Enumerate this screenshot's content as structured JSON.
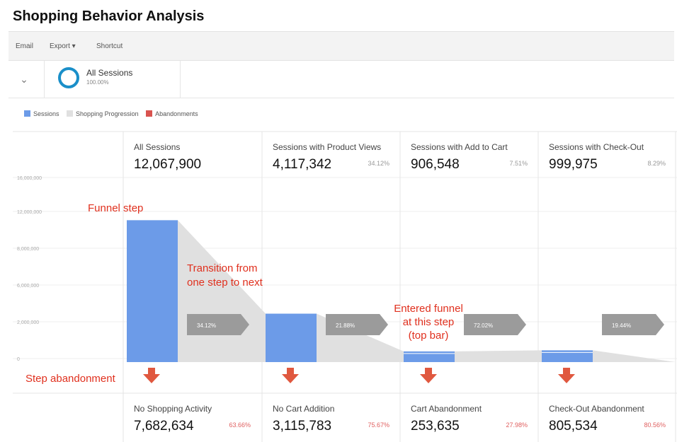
{
  "title": "Shopping Behavior Analysis",
  "toolbar": {
    "email": "Email",
    "export": "Export ▾",
    "shortcut": "Shortcut"
  },
  "segment": {
    "name": "All Sessions",
    "percent": "100.00%",
    "ring_color": "#1a8fc9"
  },
  "legend": [
    {
      "label": "Sessions",
      "color": "#6c9be8"
    },
    {
      "label": "Shopping Progression",
      "color": "#e0e0e0"
    },
    {
      "label": "Abandonments",
      "color": "#d9534f"
    }
  ],
  "chart_data": {
    "type": "bar",
    "title": "Shopping Behavior Analysis",
    "ylim": [
      0,
      16000000
    ],
    "yticks": [
      "16,000,000",
      "12,000,000",
      "8,000,000",
      "6,000,000",
      "2,000,000",
      "0"
    ],
    "steps": [
      {
        "label": "All Sessions",
        "value": 12067900,
        "value_text": "12,067,900",
        "pct": ""
      },
      {
        "label": "Sessions with Product Views",
        "value": 4117342,
        "value_text": "4,117,342",
        "pct": "34.12%"
      },
      {
        "label": "Sessions with Add to Cart",
        "value": 906548,
        "value_text": "906,548",
        "pct": "7.51%"
      },
      {
        "label": "Sessions with Check-Out",
        "value": 999975,
        "value_text": "999,975",
        "pct": "8.29%"
      }
    ],
    "transitions": [
      "34.12%",
      "21.88%",
      "72.02%",
      "19.44%"
    ],
    "abandonments": [
      {
        "label": "No Shopping Activity",
        "value": 7682634,
        "value_text": "7,682,634",
        "pct": "63.66%"
      },
      {
        "label": "No Cart Addition",
        "value": 3115783,
        "value_text": "3,115,783",
        "pct": "75.67%"
      },
      {
        "label": "Cart Abandonment",
        "value": 253635,
        "value_text": "253,635",
        "pct": "27.98%"
      },
      {
        "label": "Check-Out Abandonment",
        "value": 805534,
        "value_text": "805,534",
        "pct": "80.56%"
      }
    ],
    "annotations": {
      "funnel_step": "Funnel step",
      "transition": [
        "Transition from",
        "one step to next"
      ],
      "entered": [
        "Entered funnel",
        "at this step",
        "(top bar)"
      ],
      "step_abandonment": "Step abandonment"
    },
    "colors": {
      "bar": "#6c9be8",
      "bar_light": "#a8c3f0",
      "progression": "#e0e0e0",
      "arrow": "#9b9b9b",
      "abandon_arrow": "#e0583f",
      "annotation": "#e0301e"
    }
  }
}
